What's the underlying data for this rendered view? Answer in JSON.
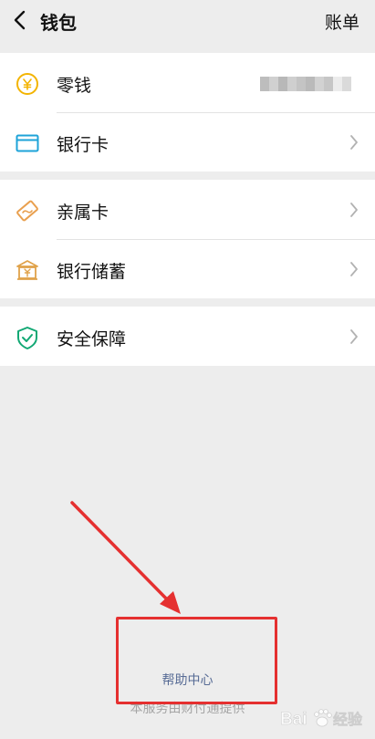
{
  "header": {
    "title": "钱包",
    "bill_label": "账单"
  },
  "groups": [
    {
      "items": [
        {
          "label": "零钱",
          "icon": "coin-yen-icon",
          "color": "#f3b400"
        },
        {
          "label": "银行卡",
          "icon": "bank-card-icon",
          "color": "#1ea3d8"
        }
      ]
    },
    {
      "items": [
        {
          "label": "亲属卡",
          "icon": "family-card-icon",
          "color": "#e9a04f"
        },
        {
          "label": "银行储蓄",
          "icon": "bank-savings-icon",
          "color": "#e0a24a"
        }
      ]
    },
    {
      "items": [
        {
          "label": "安全保障",
          "icon": "shield-icon",
          "color": "#12a874"
        }
      ]
    }
  ],
  "footer": {
    "help_label": "帮助中心",
    "provider_text": "本服务由财付通提供"
  },
  "watermark": {
    "text": "Bai经验"
  },
  "colors": {
    "background": "#ededed",
    "link": "#576b95",
    "annotation": "#e53030"
  }
}
